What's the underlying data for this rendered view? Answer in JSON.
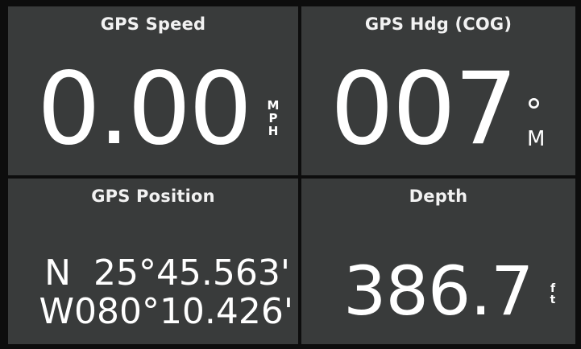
{
  "tiles": {
    "speed": {
      "title": "GPS Speed",
      "value": "0.00",
      "unit_letters": [
        "M",
        "P",
        "H"
      ]
    },
    "heading": {
      "title": "GPS Hdg (COG)",
      "value": "007",
      "degree_symbol": "°",
      "unit": "M"
    },
    "position": {
      "title": "GPS Position",
      "lat": "N  25°45.563'",
      "lon": "W080°10.426'"
    },
    "depth": {
      "title": "Depth",
      "value": "386.7",
      "unit_letters": [
        "f",
        "t"
      ]
    }
  },
  "colors": {
    "background": "#0d0d0d",
    "tile": "#393b3b",
    "text": "#ffffff"
  }
}
